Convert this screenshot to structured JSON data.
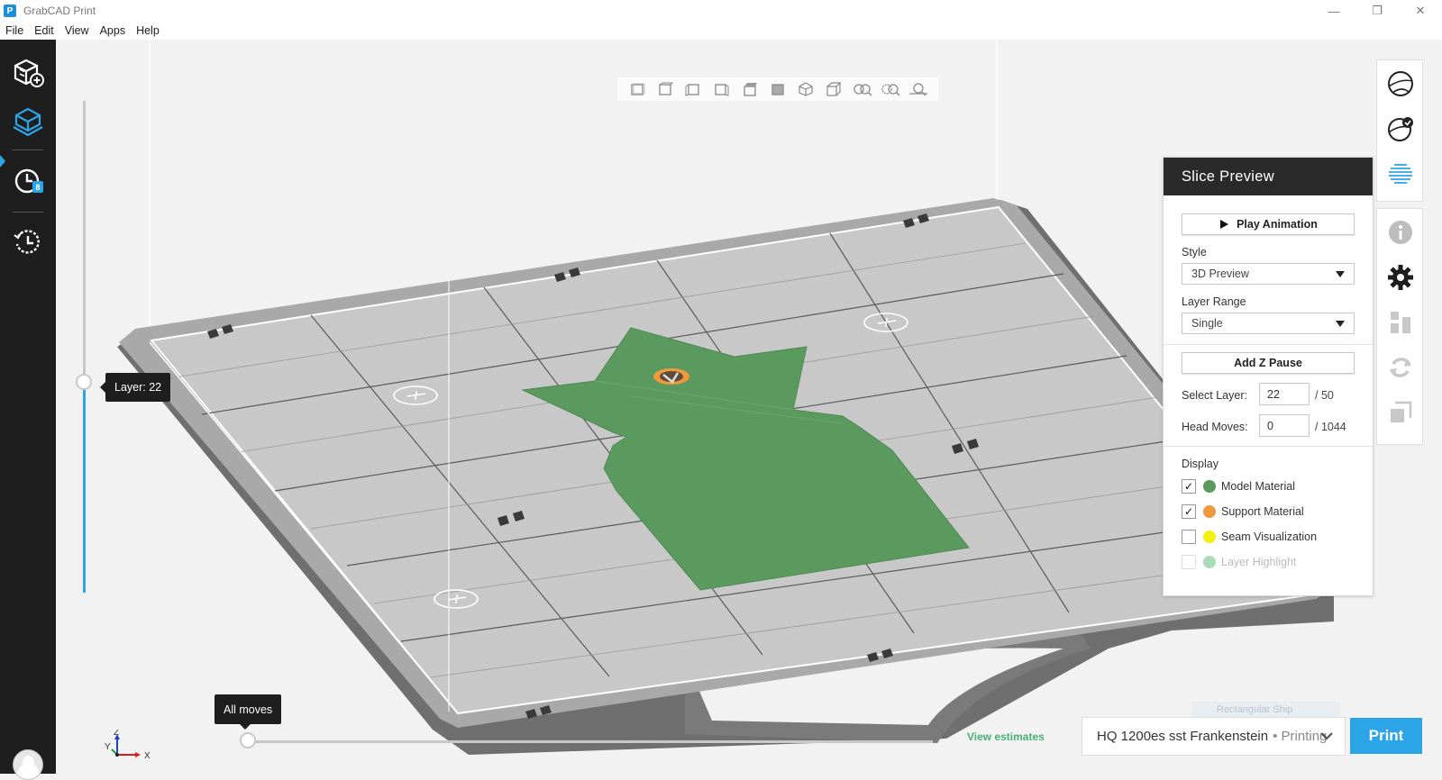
{
  "window": {
    "title": "GrabCAD Print",
    "logo_letter": "P"
  },
  "menu": [
    "File",
    "Edit",
    "View",
    "Apps",
    "Help"
  ],
  "sidebar": {
    "jobs_badge": "8"
  },
  "slider": {
    "layer_tip": "Layer: 22",
    "moves_tip": "All moves",
    "layer_fraction": 0.44
  },
  "footer": {
    "view_estimates": "View estimates",
    "printer": "HQ 1200es sst Frankenstein",
    "printer_status": "• Printing",
    "print_button": "Print"
  },
  "ghost_label": "Rectangular Ship",
  "panel": {
    "title": "Slice Preview",
    "play_animation": "Play Animation",
    "style_label": "Style",
    "style_value": "3D Preview",
    "range_label": "Layer Range",
    "range_value": "Single",
    "add_z_pause": "Add Z Pause",
    "select_layer_label": "Select Layer:",
    "select_layer_value": "22",
    "select_layer_total": "/ 50",
    "head_moves_label": "Head Moves:",
    "head_moves_value": "0",
    "head_moves_total": "/ 1044",
    "display_label": "Display",
    "display_items": [
      {
        "label": "Model Material",
        "checked": true,
        "color": "#5a9a5e"
      },
      {
        "label": "Support Material",
        "checked": true,
        "color": "#f0983c"
      },
      {
        "label": "Seam Visualization",
        "checked": false,
        "color": "#f3ef0e"
      },
      {
        "label": "Layer Highlight",
        "checked": false,
        "color": "#a8dcb8"
      }
    ]
  },
  "axes": {
    "x": "X",
    "y": "Y",
    "z": "Z"
  },
  "colors": {
    "accent": "#2ca5e8",
    "model": "#5a9a5e",
    "tray": "#c8c8c8"
  }
}
